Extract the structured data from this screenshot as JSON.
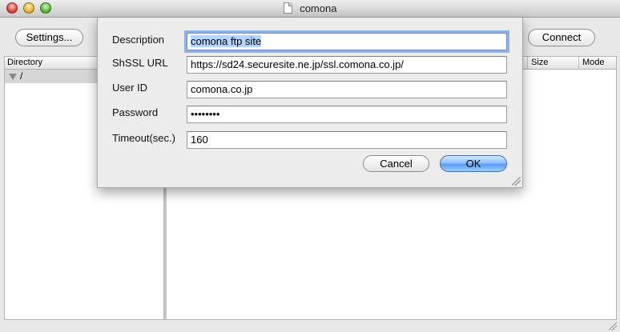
{
  "window": {
    "title": "comona"
  },
  "toolbar": {
    "settings_label": "Settings...",
    "connect_label": "Connect"
  },
  "directory": {
    "header": "Directory",
    "root_label": "/"
  },
  "file_list": {
    "columns": [
      "Size",
      "Mode"
    ]
  },
  "dialog": {
    "description_label": "Description",
    "description_value": "comona ftp site",
    "url_label": "ShSSL URL",
    "url_value": "https://sd24.securesite.ne.jp/ssl.comona.co.jp/",
    "userid_label": "User ID",
    "userid_value": "comona.co.jp",
    "password_label": "Password",
    "password_value": "••••••••",
    "timeout_label": "Timeout(sec.)",
    "timeout_value": "160",
    "cancel_label": "Cancel",
    "ok_label": "OK"
  },
  "colors": {
    "ok_button": "#5b9cf2",
    "focus_ring": "#8fb2e6",
    "selection": "#b5d5ff"
  }
}
